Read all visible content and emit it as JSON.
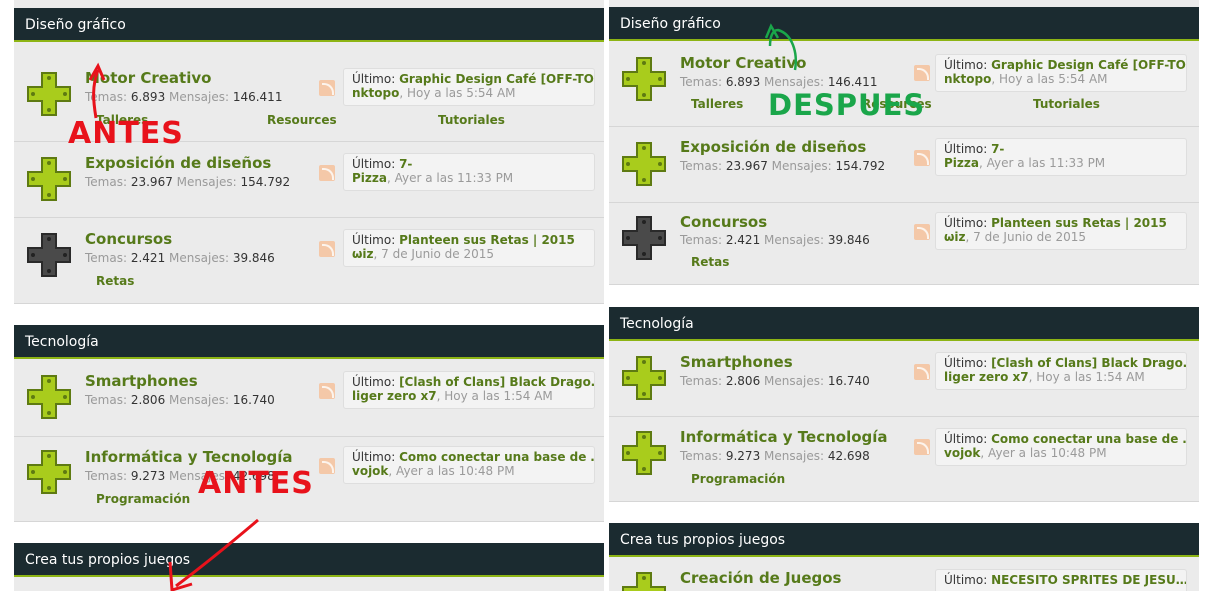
{
  "left": {
    "cat1": "Diseño gráfico",
    "cat2": "Tecnología",
    "cat3": "Crea tus propios juegos",
    "forums": {
      "motor": {
        "title": "Motor Creativo",
        "topics": "6.893",
        "posts": "146.411",
        "last_title": "Graphic Design Café [OFF-TO…",
        "last_user": "nktopo",
        "last_date": "Hoy a las 5:54 AM"
      },
      "expo": {
        "title": "Exposición de diseños",
        "topics": "23.967",
        "posts": "154.792",
        "last_title": "7-",
        "last_user": "Pizza",
        "last_date": "Ayer a las 11:33 PM"
      },
      "conc": {
        "title": "Concursos",
        "topics": "2.421",
        "posts": "39.846",
        "last_title": "Planteen sus Retas | 2015",
        "last_user": "ωiz",
        "last_date": "7 de Junio de 2015"
      },
      "smart": {
        "title": "Smartphones",
        "topics": "2.806",
        "posts": "16.740",
        "last_title": "[Clash of Clans] Black Drago…",
        "last_user": "liger zero x7",
        "last_date": "Hoy a las 1:54 AM"
      },
      "info": {
        "title": "Informática y Tecnología",
        "topics": "9.273",
        "posts": "42.698",
        "last_title": "Como conectar una base de …",
        "last_user": "vojok",
        "last_date": "Ayer a las 10:48 PM"
      }
    },
    "subs": {
      "talleres": "Talleres",
      "resources": "Resources",
      "tutoriales": "Tutoriales",
      "retas": "Retas",
      "programacion": "Programación"
    }
  },
  "right": {
    "cat1": "Diseño gráfico",
    "cat2": "Tecnología",
    "cat3": "Crea tus propios juegos",
    "forums": {
      "motor": {
        "title": "Motor Creativo",
        "topics": "6.893",
        "posts": "146.411",
        "last_title": "Graphic Design Café [OFF-TO…",
        "last_user": "nktopo",
        "last_date": "Hoy a las 5:54 AM"
      },
      "expo": {
        "title": "Exposición de diseños",
        "topics": "23.967",
        "posts": "154.792",
        "last_title": "7-",
        "last_user": "Pizza",
        "last_date": "Ayer a las 11:33 PM"
      },
      "conc": {
        "title": "Concursos",
        "topics": "2.421",
        "posts": "39.846",
        "last_title": "Planteen sus Retas | 2015",
        "last_user": "ωiz",
        "last_date": "7 de Junio de 2015"
      },
      "smart": {
        "title": "Smartphones",
        "topics": "2.806",
        "posts": "16.740",
        "last_title": "[Clash of Clans] Black Drago…",
        "last_user": "liger zero x7",
        "last_date": "Hoy a las 1:54 AM"
      },
      "info": {
        "title": "Informática y Tecnología",
        "topics": "9.273",
        "posts": "42.698",
        "last_title": "Como conectar una base de …",
        "last_user": "vojok",
        "last_date": "Ayer a las 10:48 PM"
      },
      "crea": {
        "title": "Creación de Juegos",
        "last_title": "NECESITO SPRITES DE JESU…"
      }
    },
    "subs": {
      "talleres": "Talleres",
      "resources": "Resources",
      "tutoriales": "Tutoriales",
      "retas": "Retas",
      "programacion": "Programación"
    }
  },
  "labels": {
    "topics": "Temas:",
    "posts": "Mensajes:",
    "last": "Último:"
  },
  "annotations": {
    "antes": "ANTES",
    "despues": "DESPUES"
  },
  "colors": {
    "header_bg": "#1b2b30",
    "accent": "#8db414",
    "link": "#567a1a",
    "annotation_red": "#e8121b",
    "annotation_green": "#1aa64a"
  }
}
